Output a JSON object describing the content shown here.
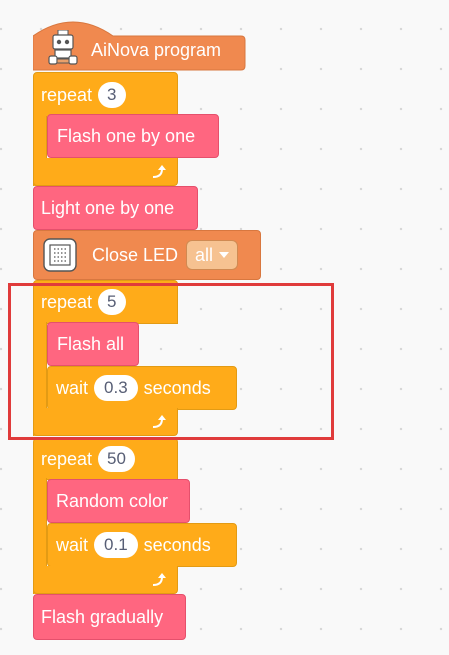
{
  "program": {
    "hat_label": "AiNova program",
    "blocks": {
      "repeat1": {
        "label": "repeat",
        "count": "3"
      },
      "flash_one_by_one": {
        "label": "Flash one by one"
      },
      "light_one_by_one": {
        "label": "Light one by one"
      },
      "close_led": {
        "label": "Close LED",
        "option": "all"
      },
      "repeat2": {
        "label": "repeat",
        "count": "5"
      },
      "flash_all": {
        "label": "Flash all"
      },
      "wait1": {
        "label": "wait",
        "value": "0.3",
        "unit": "seconds"
      },
      "repeat3": {
        "label": "repeat",
        "count": "50"
      },
      "random_color": {
        "label": "Random color"
      },
      "wait2": {
        "label": "wait",
        "value": "0.1",
        "unit": "seconds"
      },
      "flash_gradually": {
        "label": "Flash gradually"
      }
    }
  },
  "icons": {
    "hat": "robot-icon",
    "close_led": "led-matrix-icon",
    "loop": "loop-arrow-icon"
  },
  "colors": {
    "control": "#ffab19",
    "looks": "#ff6680",
    "extension": "#f0894f",
    "highlight": "#e03b3b"
  }
}
